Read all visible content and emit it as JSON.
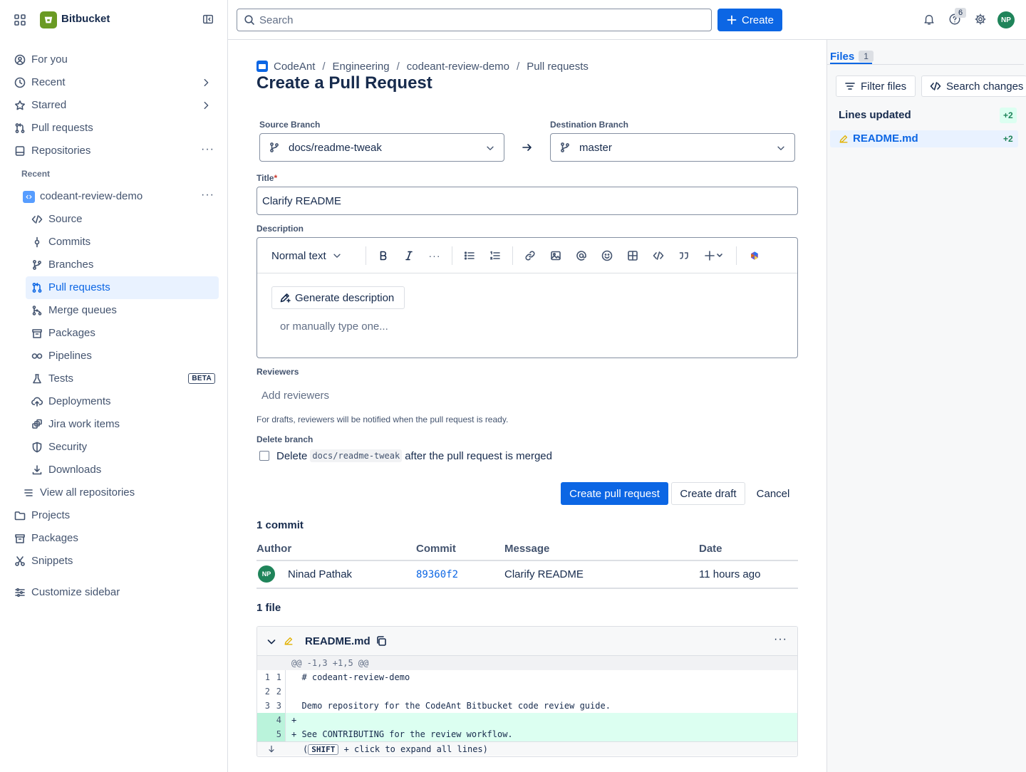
{
  "app": {
    "name": "Bitbucket"
  },
  "sidebar": {
    "items": [
      {
        "label": "For you",
        "icon": "for-you-icon"
      },
      {
        "label": "Recent",
        "icon": "clock-icon"
      },
      {
        "label": "Starred",
        "icon": "star-icon"
      },
      {
        "label": "Pull requests",
        "icon": "pull-request-icon"
      },
      {
        "label": "Repositories",
        "icon": "repository-icon"
      }
    ],
    "recent_label": "Recent",
    "repo": {
      "name": "codeant-review-demo"
    },
    "repo_items": [
      {
        "label": "Source",
        "icon": "code-icon"
      },
      {
        "label": "Commits",
        "icon": "commit-icon"
      },
      {
        "label": "Branches",
        "icon": "branch-icon"
      },
      {
        "label": "Pull requests",
        "icon": "pull-request-icon"
      },
      {
        "label": "Merge queues",
        "icon": "merge-queue-icon"
      },
      {
        "label": "Packages",
        "icon": "package-icon"
      },
      {
        "label": "Pipelines",
        "icon": "pipeline-icon"
      },
      {
        "label": "Tests",
        "icon": "test-icon",
        "badge": "BETA"
      },
      {
        "label": "Deployments",
        "icon": "deployment-icon"
      },
      {
        "label": "Jira work items",
        "icon": "jira-icon"
      },
      {
        "label": "Security",
        "icon": "shield-icon"
      },
      {
        "label": "Downloads",
        "icon": "download-icon"
      }
    ],
    "view_all": "View all repositories",
    "bottom_items": [
      {
        "label": "Projects",
        "icon": "folder-icon"
      },
      {
        "label": "Packages",
        "icon": "package-icon"
      },
      {
        "label": "Snippets",
        "icon": "scissors-icon"
      }
    ],
    "customize": "Customize sidebar"
  },
  "topbar": {
    "search_placeholder": "Search",
    "create_label": "Create",
    "notifications_count": "6",
    "avatar_initials": "NP"
  },
  "breadcrumb": [
    "CodeAnt",
    "Engineering",
    "codeant-review-demo",
    "Pull requests"
  ],
  "page_title": "Create a Pull Request",
  "form": {
    "source_label": "Source Branch",
    "source_value": "docs/readme-tweak",
    "destination_label": "Destination Branch",
    "destination_value": "master",
    "title_label": "Title",
    "required_mark": "*",
    "title_value": "Clarify README",
    "description_label": "Description",
    "format_select": "Normal text",
    "generate_label": "Generate description",
    "manual_hint": "or manually type one...",
    "reviewers_label": "Reviewers",
    "reviewers_placeholder": "Add reviewers",
    "drafts_hint": "For drafts, reviewers will be notified when the pull request is ready.",
    "delete_label": "Delete branch",
    "delete_prefix": "Delete",
    "delete_branch": "docs/readme-tweak",
    "delete_suffix": "after the pull request is merged",
    "create_pr": "Create pull request",
    "create_draft": "Create draft",
    "cancel": "Cancel"
  },
  "commits": {
    "heading": "1 commit",
    "columns": [
      "Author",
      "Commit",
      "Message",
      "Date"
    ],
    "rows": [
      {
        "initials": "NP",
        "author": "Ninad Pathak",
        "hash": "89360f2",
        "message": "Clarify README",
        "date": "11 hours ago"
      }
    ]
  },
  "files": {
    "heading": "1 file",
    "file_name": "README.md",
    "hunk": "@@ -1,3 +1,5 @@",
    "lines": [
      {
        "old": "1",
        "new": "1",
        "text": "  # codeant-review-demo",
        "type": "context"
      },
      {
        "old": "2",
        "new": "2",
        "text": "",
        "type": "context"
      },
      {
        "old": "3",
        "new": "3",
        "text": "  Demo repository for the CodeAnt Bitbucket code review guide.",
        "type": "context"
      },
      {
        "old": "",
        "new": "4",
        "text": "+",
        "type": "added"
      },
      {
        "old": "",
        "new": "5",
        "text": "+ See CONTRIBUTING for the review workflow.",
        "type": "added"
      }
    ],
    "expand_open": "(",
    "expand_key": "SHIFT",
    "expand_rest": " + click to expand all lines)"
  },
  "right_panel": {
    "tab_label": "Files",
    "tab_count": "1",
    "filter_label": "Filter files",
    "search_label": "Search changes",
    "lines_updated": "Lines updated",
    "lines_count": "+2",
    "file_name": "README.md",
    "file_count": "+2"
  },
  "colors": {
    "accent": "#0c66e4",
    "brand": "#6a9a23",
    "added_bg": "#dcfff1",
    "avatar": "#1f845a"
  }
}
